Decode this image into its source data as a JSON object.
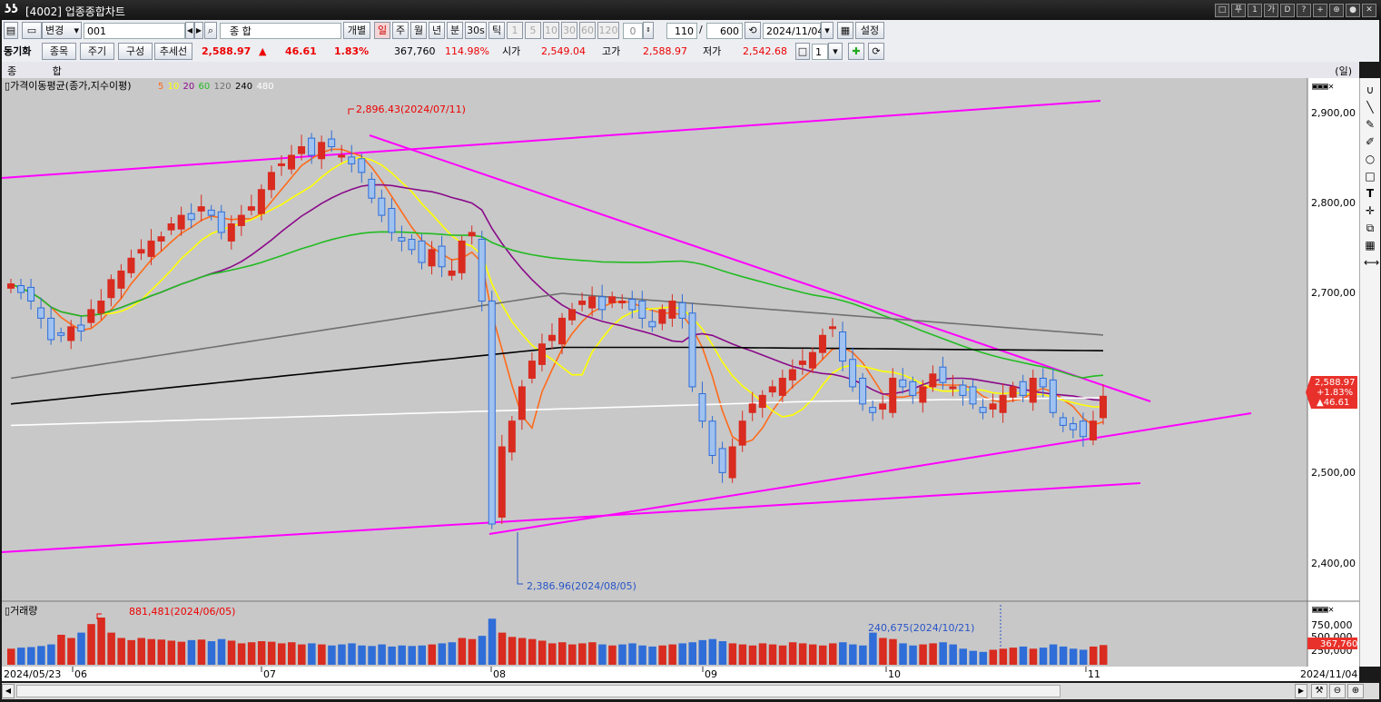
{
  "window": {
    "title": "[4002] 업종종합차트",
    "controls": [
      "□",
      "푸",
      "1",
      "가",
      "D",
      "?",
      "+",
      "⊕",
      "●",
      "✕"
    ]
  },
  "toolbar1": {
    "change_label": "변경",
    "code": "001",
    "name": "종 합",
    "individual": "개별",
    "periods": [
      "일",
      "주",
      "월",
      "년",
      "분",
      "30s",
      "틱"
    ],
    "selected_period": "일",
    "intervals": [
      "1",
      "5",
      "10",
      "30",
      "60",
      "120"
    ],
    "interval_input": "0",
    "count": "110",
    "total": "600",
    "date": "2024/11/04",
    "settings": "설정"
  },
  "toolbar2": {
    "sync_label": "동기화",
    "item_btn": "종목",
    "period_btn": "주기",
    "compose_btn": "구성",
    "trend_btn": "추세선",
    "price": "2,588.97",
    "arrow": "▲",
    "change": "46.61",
    "change_pct": "1.83%",
    "volume": "367,760",
    "vol_ratio": "114.98%",
    "open_label": "시가",
    "open": "2,549.04",
    "high_label": "고가",
    "high": "2,588.97",
    "low_label": "저가",
    "low": "2,542.68",
    "spin_value": "1"
  },
  "price_pane": {
    "header_left": "종 합",
    "header_right": "(일)",
    "indicator_title": "가격이동평균(종가,지수이평)",
    "ma_periods": [
      {
        "label": "5",
        "color": "#ff6a1a"
      },
      {
        "label": "10",
        "color": "#ffff00"
      },
      {
        "label": "20",
        "color": "#8a0a8a"
      },
      {
        "label": "60",
        "color": "#22bb22"
      },
      {
        "label": "120",
        "color": "#707070"
      },
      {
        "label": "240",
        "color": "#000000"
      },
      {
        "label": "480",
        "color": "#ffffff"
      }
    ],
    "y_ticks": [
      "2,900,00",
      "2,800,00",
      "2,700,00",
      "2,500,00",
      "2,400,00"
    ],
    "high_annotation": "2,896.43(2024/07/11)",
    "low_annotation": "2,386.96(2024/08/05)",
    "current_tag": [
      "2,588.97",
      "+1.83%",
      "▲46.61"
    ]
  },
  "volume_pane": {
    "title": "거래량",
    "max_annotation": "881,481(2024/06/05)",
    "mid_annotation": "240,675(2024/10/21)",
    "y_ticks": [
      "750,000",
      "500,000",
      "250,000"
    ],
    "current_tag": "367,760"
  },
  "x_axis": {
    "start": "2024/05/23",
    "months": [
      "06",
      "07",
      "08",
      "09",
      "10",
      "11"
    ],
    "end": "2024/11/04"
  },
  "chart_data": {
    "type": "candlestick",
    "title": "종 합",
    "period": "일",
    "ylim": [
      2350,
      2960
    ],
    "ohlc_note": "last candle open 2,549.04 high 2,588.97 low 2,542.68 close 2,588.97",
    "closes": [
      2720,
      2710,
      2700,
      2680,
      2655,
      2660,
      2670,
      2665,
      2690,
      2700,
      2725,
      2735,
      2750,
      2760,
      2770,
      2775,
      2790,
      2800,
      2795,
      2810,
      2800,
      2780,
      2790,
      2800,
      2810,
      2830,
      2850,
      2860,
      2870,
      2880,
      2870,
      2885,
      2880,
      2870,
      2860,
      2850,
      2820,
      2800,
      2780,
      2770,
      2760,
      2745,
      2760,
      2740,
      2735,
      2770,
      2780,
      2700,
      2440,
      2530,
      2560,
      2600,
      2630,
      2650,
      2660,
      2680,
      2690,
      2700,
      2705,
      2690,
      2705,
      2700,
      2690,
      2680,
      2670,
      2690,
      2700,
      2680,
      2600,
      2560,
      2520,
      2500,
      2530,
      2560,
      2580,
      2590,
      2600,
      2610,
      2620,
      2630,
      2640,
      2660,
      2670,
      2630,
      2600,
      2580,
      2570,
      2580,
      2610,
      2600,
      2590,
      2600,
      2615,
      2605,
      2600,
      2590,
      2580,
      2570,
      2580,
      2590,
      2600,
      2590,
      2610,
      2600,
      2570,
      2555,
      2550,
      2542,
      2560,
      2589
    ],
    "volumes": [
      300000,
      320000,
      330000,
      350000,
      380000,
      560000,
      500000,
      600000,
      760000,
      881481,
      600000,
      500000,
      460000,
      500000,
      480000,
      470000,
      450000,
      430000,
      460000,
      470000,
      440000,
      480000,
      450000,
      400000,
      420000,
      440000,
      430000,
      400000,
      420000,
      380000,
      400000,
      380000,
      360000,
      380000,
      400000,
      360000,
      350000,
      380000,
      340000,
      360000,
      350000,
      360000,
      380000,
      400000,
      420000,
      500000,
      480000,
      540000,
      860000,
      600000,
      520000,
      500000,
      480000,
      450000,
      400000,
      420000,
      380000,
      400000,
      420000,
      380000,
      360000,
      380000,
      400000,
      360000,
      340000,
      360000,
      380000,
      400000,
      420000,
      460000,
      480000,
      440000,
      400000,
      380000,
      360000,
      400000,
      380000,
      360000,
      420000,
      400000,
      380000,
      360000,
      400000,
      420000,
      380000,
      360000,
      600000,
      500000,
      480000,
      400000,
      360000,
      380000,
      400000,
      420000,
      380000,
      300000,
      260000,
      240675,
      280000,
      300000,
      320000,
      340000,
      300000,
      320000,
      380000,
      340000,
      300000,
      280000,
      340000,
      367760
    ],
    "ma_series": [
      "5",
      "10",
      "20",
      "60",
      "120",
      "240",
      "480"
    ]
  }
}
